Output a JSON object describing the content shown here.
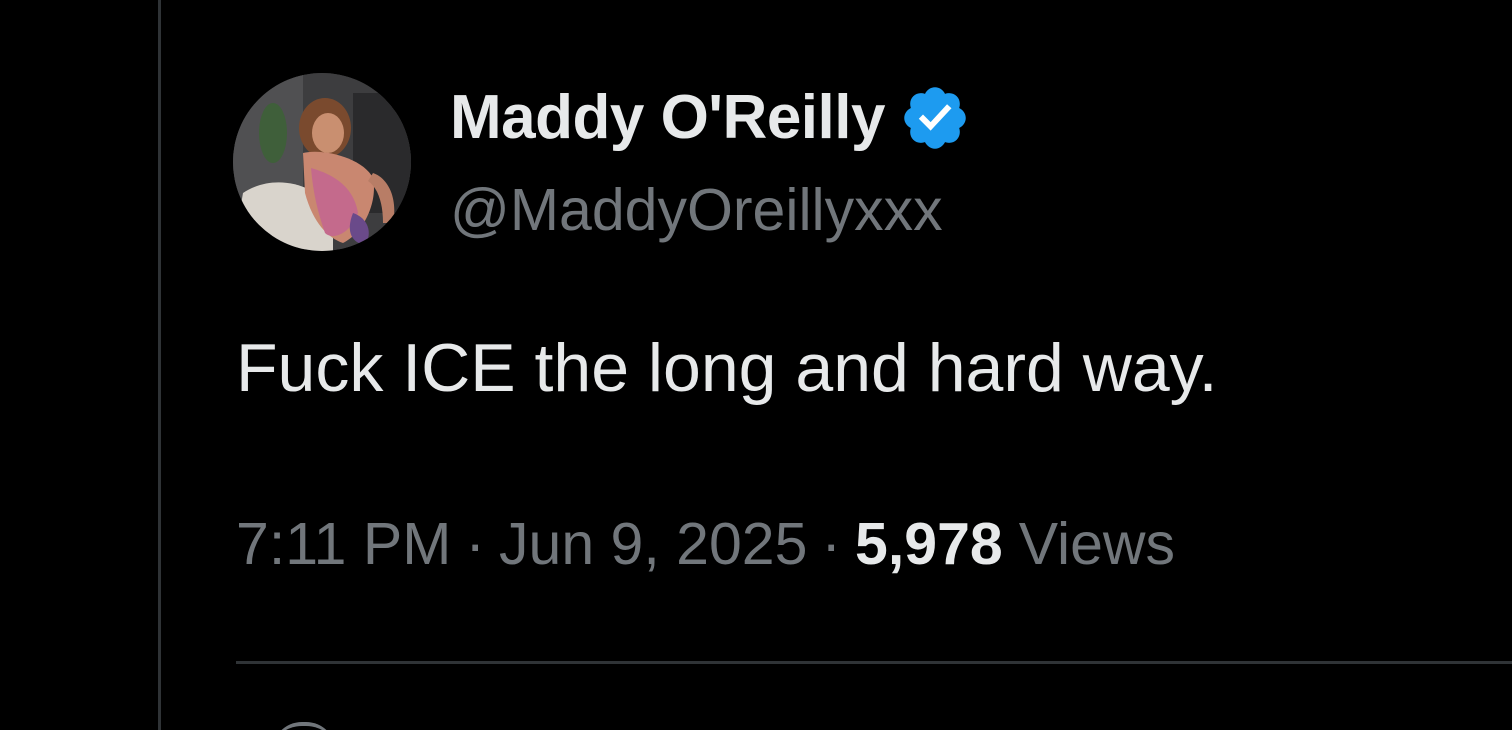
{
  "author": {
    "display_name": "Maddy O'Reilly",
    "handle": "@MaddyOreillyxxx",
    "verified": true,
    "avatar_icon": "profile-photo",
    "badge_icon": "verified-badge-icon"
  },
  "tweet": {
    "text": "Fuck ICE the long and hard way.",
    "time": "7:11 PM",
    "separator": "·",
    "date": "Jun 9, 2025",
    "views_count": "5,978",
    "views_label": "Views"
  },
  "colors": {
    "background": "#000000",
    "primary_text": "#e7e9ea",
    "secondary_text": "#71767b",
    "divider": "#2f3336",
    "verified_blue": "#1d9bf0"
  }
}
